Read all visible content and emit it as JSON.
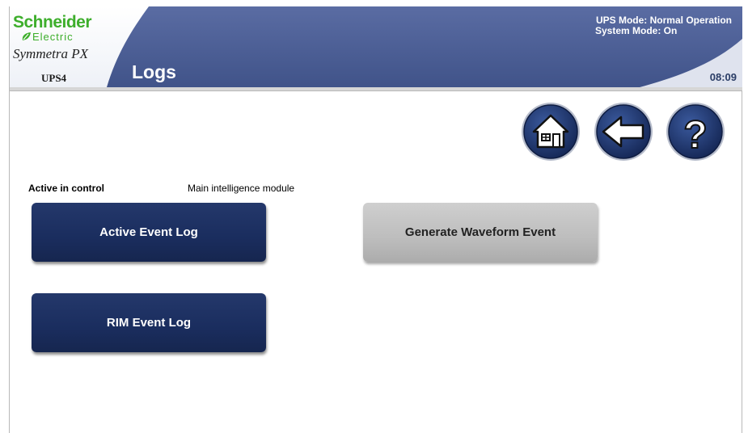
{
  "header": {
    "brand": "Schneider",
    "brand_sub": "Electric",
    "product": "Symmetra PX",
    "device": "UPS4",
    "title": "Logs",
    "ups_mode": "UPS Mode: Normal Operation",
    "system_mode": "System Mode: On",
    "time": "08:09"
  },
  "nav": {
    "home_icon": "home-icon",
    "back_icon": "arrow-left-icon",
    "help_icon": "question-icon"
  },
  "info": {
    "active_label": "Active in control",
    "active_value": "Main intelligence module"
  },
  "buttons": {
    "active_event_log": "Active Event Log",
    "rim_event_log": "RIM Event Log",
    "generate_waveform": "Generate Waveform Event"
  },
  "colors": {
    "header_blue": "#4c5f96",
    "brand_green": "#3dae2b",
    "button_blue": "#1a2d5e",
    "button_gray": "#bdbdbd"
  }
}
